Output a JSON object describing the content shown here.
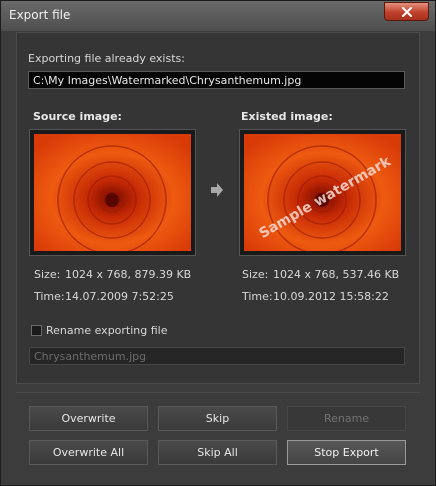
{
  "window": {
    "title": "Export file"
  },
  "existing_label": "Exporting file already exists:",
  "existing_path": "C:\\My Images\\Watermarked\\Chrysanthemum.jpg",
  "source": {
    "heading": "Source image:",
    "size_label": "Size:",
    "size_value": "1024 x 768, 879.39 KB",
    "time_label": "Time:",
    "time_value": "14.07.2009 7:52:25"
  },
  "existed": {
    "heading": "Existed image:",
    "watermark": "Sample watermark",
    "size_label": "Size:",
    "size_value": "1024 x 768, 537.46 KB",
    "time_label": "Time:",
    "time_value": "10.09.2012 15:58:22"
  },
  "rename": {
    "checkbox_label": "Rename exporting file",
    "checked": false,
    "filename_placeholder": "Chrysanthemum.jpg"
  },
  "buttons": {
    "overwrite": "Overwrite",
    "skip": "Skip",
    "rename": "Rename",
    "overwrite_all": "Overwrite All",
    "skip_all": "Skip All",
    "stop_export": "Stop Export"
  },
  "icons": {
    "close": "close-icon",
    "arrow": "arrow-right-icon"
  }
}
